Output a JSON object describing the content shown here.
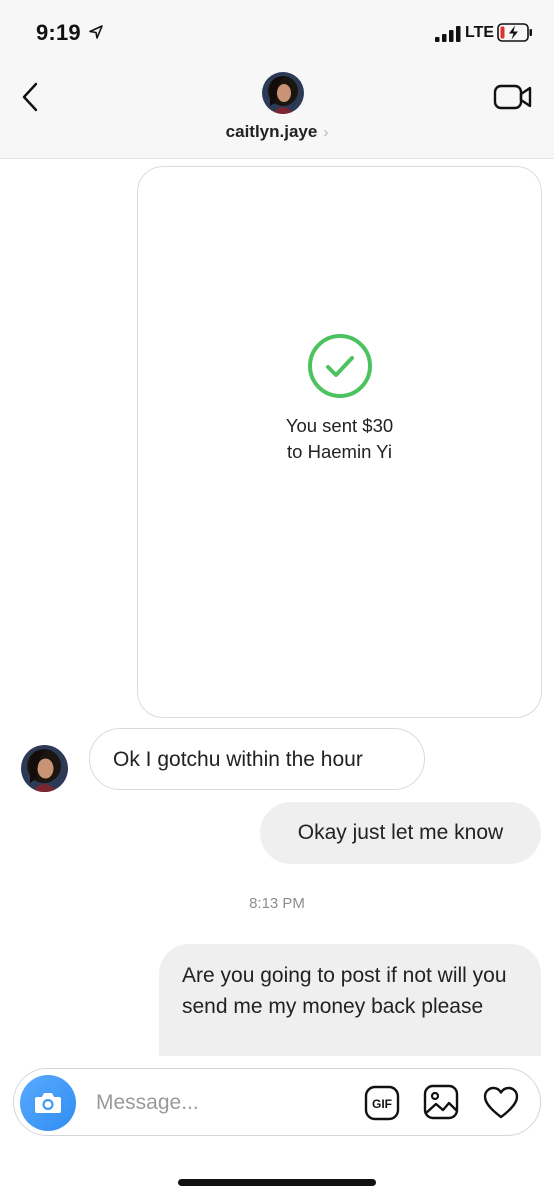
{
  "status_bar": {
    "time": "9:19",
    "network": "LTE",
    "icons": [
      "location-arrow-icon",
      "signal-icon",
      "battery-charging-icon"
    ]
  },
  "header": {
    "username": "caitlyn.jaye",
    "chevron": "›",
    "icons": [
      "back-chevron-icon",
      "video-call-icon"
    ]
  },
  "payment": {
    "line1": "You sent $30",
    "line2": "to Haemin Yi",
    "icon": "check-circle-icon",
    "accent": "#4cc35f"
  },
  "messages": [
    {
      "direction": "incoming",
      "text": "Ok I gotchu within the hour"
    },
    {
      "direction": "outgoing",
      "text": "Okay just let me know"
    },
    {
      "direction": "outgoing",
      "text": "Are you going to post if not will you send me my money back please"
    }
  ],
  "timestamp": "8:13 PM",
  "composer": {
    "placeholder": "Message...",
    "gif_label": "GIF",
    "icons": [
      "camera-icon",
      "gif-icon",
      "gallery-icon",
      "heart-icon"
    ],
    "camera_color": "#3b95f5"
  }
}
